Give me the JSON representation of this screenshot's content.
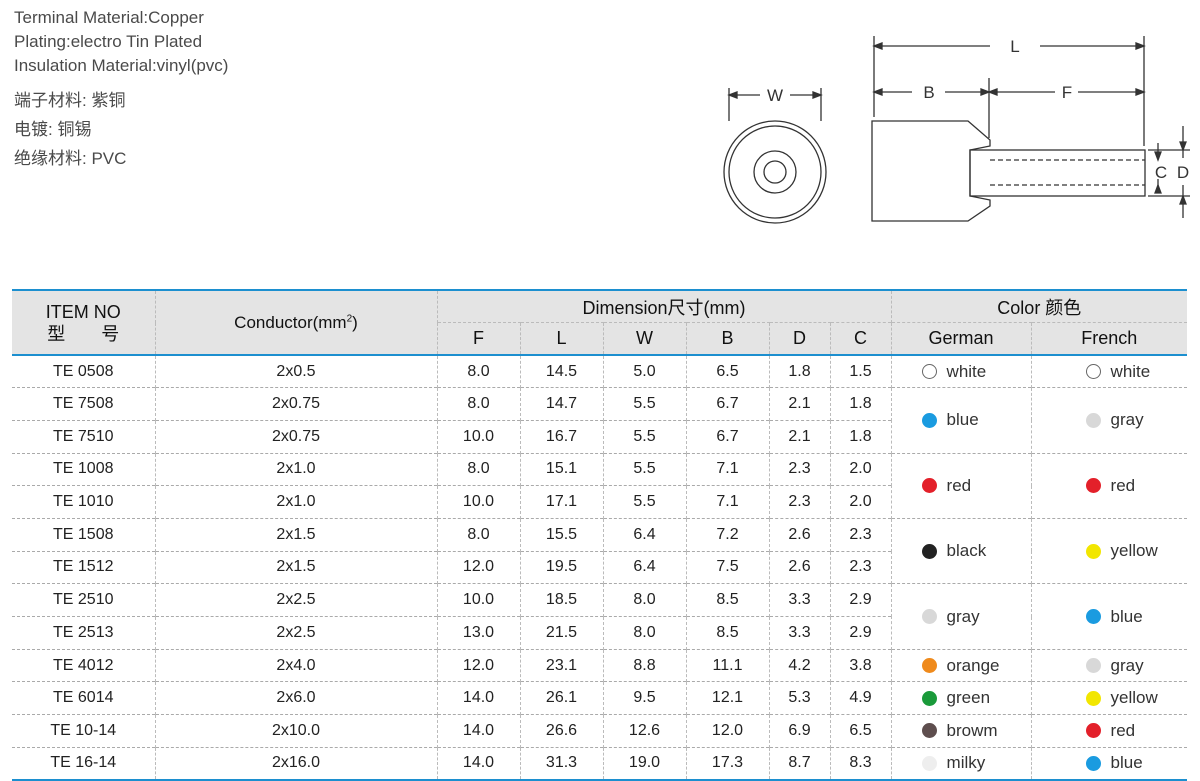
{
  "specs": {
    "en": [
      "Terminal Material:Copper",
      "Plating:electro Tin Plated",
      "Insulation Material:vinyl(pvc)"
    ],
    "cn": [
      "端子材料: 紫铜",
      "电镀: 铜锡",
      "绝缘材料: PVC"
    ]
  },
  "drawing": {
    "labels": {
      "w": "W",
      "l": "L",
      "b": "B",
      "f": "F",
      "c": "C",
      "d": "D"
    }
  },
  "table": {
    "headers": {
      "item_line1": "ITEM NO",
      "item_line2": "型　　号",
      "conductor": "Conductor(mm",
      "conductor_sup": "2",
      "conductor_close": ")",
      "dimension": "Dimension尺寸(mm)",
      "color": "Color 颜色",
      "dims": [
        "F",
        "L",
        "W",
        "B",
        "D",
        "C"
      ],
      "german": "German",
      "french": "French"
    },
    "rows": [
      {
        "item": "TE 0508",
        "cond": "2x0.5",
        "F": "8.0",
        "L": "14.5",
        "W": "5.0",
        "B": "6.5",
        "D": "1.8",
        "C": "1.5"
      },
      {
        "item": "TE 7508",
        "cond": "2x0.75",
        "F": "8.0",
        "L": "14.7",
        "W": "5.5",
        "B": "6.7",
        "D": "2.1",
        "C": "1.8"
      },
      {
        "item": "TE 7510",
        "cond": "2x0.75",
        "F": "10.0",
        "L": "16.7",
        "W": "5.5",
        "B": "6.7",
        "D": "2.1",
        "C": "1.8"
      },
      {
        "item": "TE 1008",
        "cond": "2x1.0",
        "F": "8.0",
        "L": "15.1",
        "W": "5.5",
        "B": "7.1",
        "D": "2.3",
        "C": "2.0"
      },
      {
        "item": "TE 1010",
        "cond": "2x1.0",
        "F": "10.0",
        "L": "17.1",
        "W": "5.5",
        "B": "7.1",
        "D": "2.3",
        "C": "2.0"
      },
      {
        "item": "TE 1508",
        "cond": "2x1.5",
        "F": "8.0",
        "L": "15.5",
        "W": "6.4",
        "B": "7.2",
        "D": "2.6",
        "C": "2.3"
      },
      {
        "item": "TE 1512",
        "cond": "2x1.5",
        "F": "12.0",
        "L": "19.5",
        "W": "6.4",
        "B": "7.5",
        "D": "2.6",
        "C": "2.3"
      },
      {
        "item": "TE 2510",
        "cond": "2x2.5",
        "F": "10.0",
        "L": "18.5",
        "W": "8.0",
        "B": "8.5",
        "D": "3.3",
        "C": "2.9"
      },
      {
        "item": "TE 2513",
        "cond": "2x2.5",
        "F": "13.0",
        "L": "21.5",
        "W": "8.0",
        "B": "8.5",
        "D": "3.3",
        "C": "2.9"
      },
      {
        "item": "TE 4012",
        "cond": "2x4.0",
        "F": "12.0",
        "L": "23.1",
        "W": "8.8",
        "B": "11.1",
        "D": "4.2",
        "C": "3.8"
      },
      {
        "item": "TE 6014",
        "cond": "2x6.0",
        "F": "14.0",
        "L": "26.1",
        "W": "9.5",
        "B": "12.1",
        "D": "5.3",
        "C": "4.9"
      },
      {
        "item": "TE 10-14",
        "cond": "2x10.0",
        "F": "14.0",
        "L": "26.6",
        "W": "12.6",
        "B": "12.0",
        "D": "6.9",
        "C": "6.5"
      },
      {
        "item": "TE 16-14",
        "cond": "2x16.0",
        "F": "14.0",
        "L": "31.3",
        "W": "19.0",
        "B": "17.3",
        "D": "8.7",
        "C": "8.3"
      }
    ],
    "colors": [
      {
        "span": 1,
        "german": {
          "name": "white",
          "hex": "#ffffff"
        },
        "french": {
          "name": "white",
          "hex": "#ffffff"
        }
      },
      {
        "span": 2,
        "german": {
          "name": "blue",
          "hex": "#1a9be0"
        },
        "french": {
          "name": "gray",
          "hex": "#d8d8d8"
        }
      },
      {
        "span": 2,
        "german": {
          "name": "red",
          "hex": "#e3202a"
        },
        "french": {
          "name": "red",
          "hex": "#e3202a"
        }
      },
      {
        "span": 2,
        "german": {
          "name": "black",
          "hex": "#222222"
        },
        "french": {
          "name": "yellow",
          "hex": "#f2e600"
        }
      },
      {
        "span": 2,
        "german": {
          "name": "gray",
          "hex": "#d8d8d8"
        },
        "french": {
          "name": "blue",
          "hex": "#1a9be0"
        }
      },
      {
        "span": 1,
        "german": {
          "name": "orange",
          "hex": "#ef8a1c"
        },
        "french": {
          "name": "gray",
          "hex": "#d8d8d8"
        }
      },
      {
        "span": 1,
        "german": {
          "name": "green",
          "hex": "#1a9a3a"
        },
        "french": {
          "name": "yellow",
          "hex": "#f2e600"
        }
      },
      {
        "span": 1,
        "german": {
          "name": "browm",
          "hex": "#5e4e4e"
        },
        "french": {
          "name": "red",
          "hex": "#e3202a"
        }
      },
      {
        "span": 1,
        "german": {
          "name": "milky",
          "hex": "#eeeeee"
        },
        "french": {
          "name": "blue",
          "hex": "#1a9be0"
        }
      }
    ]
  }
}
